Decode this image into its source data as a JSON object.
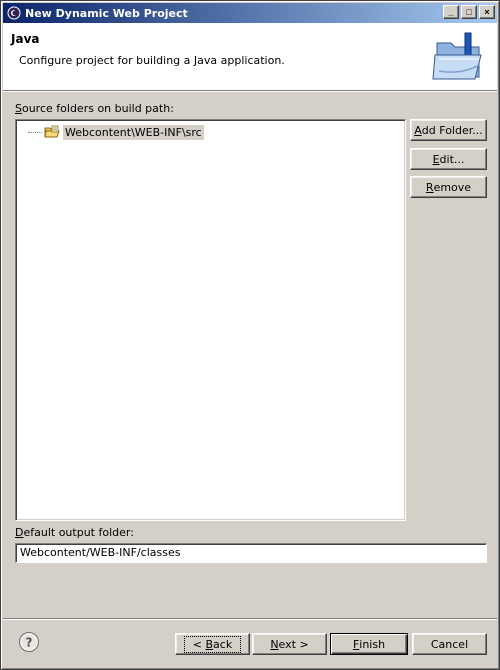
{
  "window": {
    "title": "New Dynamic Web Project",
    "controls": [
      "_",
      "□",
      "×"
    ]
  },
  "banner": {
    "title": "Java",
    "description": "Configure project for building a Java application.",
    "graphic": "java-folder-wizard-icon"
  },
  "source_section": {
    "label_pre": "",
    "label_mnemonic": "S",
    "label_post": "ource folders on build path:",
    "items": [
      {
        "label": "Webcontent\\WEB-INF\\src",
        "icon": "source-folder-icon"
      }
    ],
    "buttons": {
      "add_pre": "",
      "add_mn": "A",
      "add_post": "dd Folder...",
      "edit_pre": "",
      "edit_mn": "E",
      "edit_post": "dit...",
      "remove_pre": "",
      "remove_mn": "R",
      "remove_post": "emove"
    }
  },
  "output_section": {
    "label_pre": "",
    "label_mnemonic": "D",
    "label_post": "efault output folder:",
    "value": "Webcontent/WEB-INF/classes"
  },
  "footer": {
    "help_icon": "help-icon",
    "back_pre": "< ",
    "back_mn": "B",
    "back_post": "ack",
    "next_pre": "",
    "next_mn": "N",
    "next_post": "ext >",
    "finish_pre": "",
    "finish_mn": "F",
    "finish_post": "inish",
    "cancel": "Cancel"
  },
  "colors": {
    "title_start": "#0a246a",
    "title_end": "#a6caf0",
    "face": "#d4d0c8"
  }
}
